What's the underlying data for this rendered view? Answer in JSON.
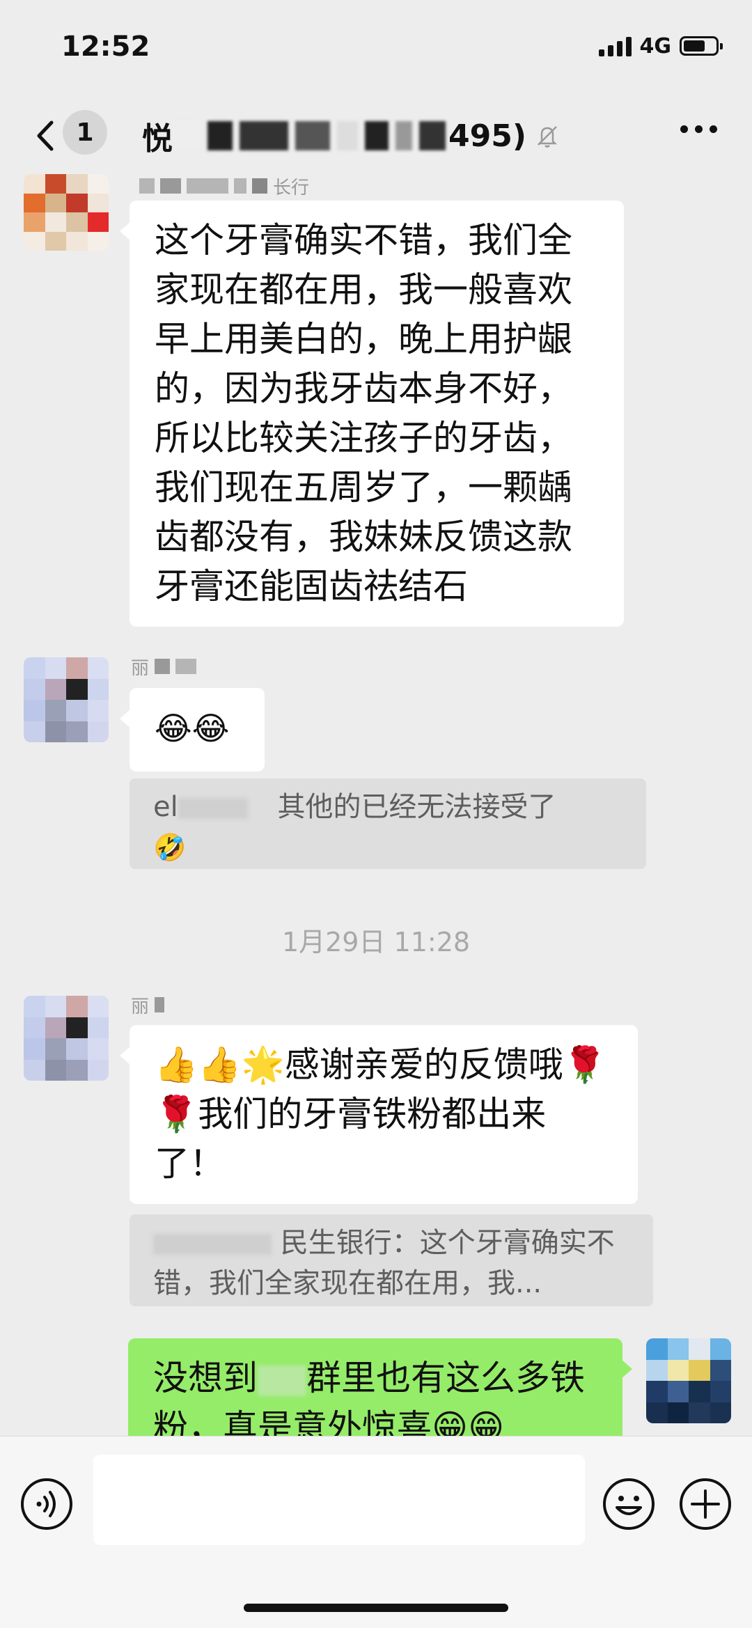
{
  "status_bar": {
    "time": "12:52",
    "network": "4G"
  },
  "header": {
    "unread_count": "1",
    "title_visible": "495)",
    "title_prefix": "悦"
  },
  "messages": {
    "m1": {
      "sender_suffix": "长行",
      "text": "这个牙膏确实不错，我们全家现在都在用，我一般喜欢早上用美白的，晚上用护龈的，因为我牙齿本身不好，所以比较关注孩子的牙齿，我们现在五周岁了，一颗龋齿都没有，我妹妹反馈这款牙膏还能固齿祛结石"
    },
    "m2": {
      "sender_initial": "丽",
      "text": "😂😂",
      "quote_prefix": "el",
      "quote_text": "其他的已经无法接受了",
      "quote_emoji": "🤣"
    },
    "timestamp": "1月29日 11:28",
    "m3": {
      "sender_initial": "丽",
      "text": "👍👍🌟感谢亲爱的反馈哦🌹🌹我们的牙膏铁粉都出来了！",
      "quote_text": "民生银行：这个牙膏确实不错，我们全家现在都在用，我..."
    },
    "m4": {
      "text_part1": "没想到",
      "text_part2": "群里也有这么多铁粉，真是意外惊喜😁😁"
    }
  },
  "input": {
    "placeholder": ""
  },
  "colors": {
    "background": "#ededed",
    "bubble_in": "#ffffff",
    "bubble_out": "#95ec69",
    "quote_bg": "#dedede"
  },
  "icons": [
    "back-icon",
    "mute-icon",
    "more-icon",
    "voice-icon",
    "emoji-icon",
    "plus-icon"
  ]
}
